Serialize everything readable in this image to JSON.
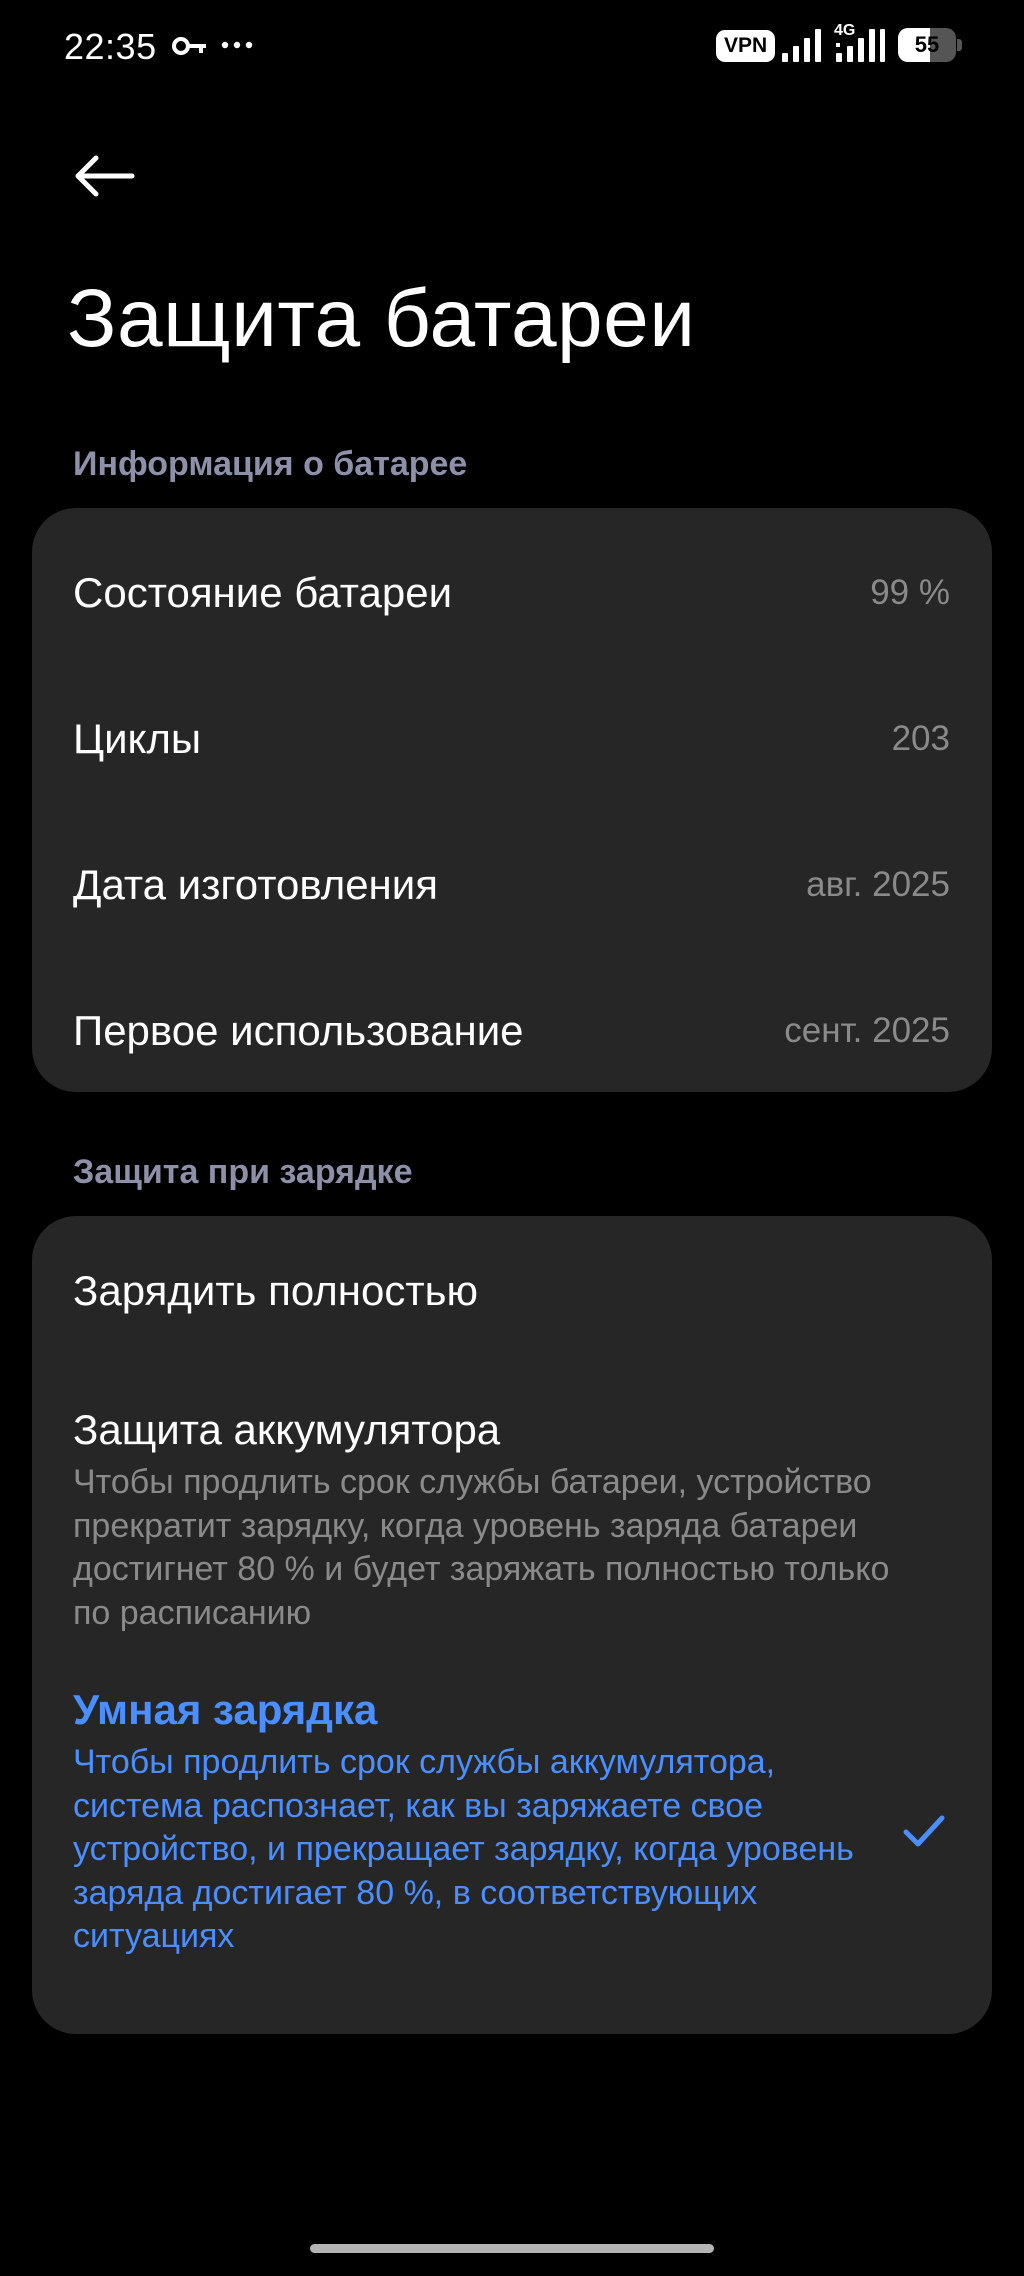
{
  "status_bar": {
    "time": "22:35",
    "vpn": "VPN",
    "network_type": "4G",
    "battery_level": "55",
    "battery_fraction": 0.55,
    "icons": [
      "key-icon",
      "more-icon",
      "signal-icon",
      "signal-icon",
      "battery-icon"
    ]
  },
  "header": {
    "back_icon": "arrow-left-icon",
    "title": "Защита батареи"
  },
  "battery_info": {
    "section_title": "Информация о батарее",
    "rows": [
      {
        "label": "Состояние батареи",
        "value": "99 %"
      },
      {
        "label": "Циклы",
        "value": "203"
      },
      {
        "label": "Дата изготовления",
        "value": "авг. 2025"
      },
      {
        "label": "Первое использование",
        "value": "сент. 2025"
      }
    ]
  },
  "charging_protection": {
    "section_title": "Защита при зарядке",
    "options": [
      {
        "title": "Зарядить полностью",
        "description": "",
        "selected": false
      },
      {
        "title": "Защита аккумулятора",
        "description": "Чтобы продлить срок службы батареи, устройство прекратит зарядку, когда уровень заряда батареи достигнет 80 % и будет заряжать полностью только по расписанию",
        "selected": false
      },
      {
        "title": "Умная зарядка",
        "description": "Чтобы продлить срок службы аккумулятора, система распознает, как вы заряжаете свое устройство, и прекращает зарядку, когда уровень заряда достигает 80 %, в соответствующих ситуациях",
        "selected": true
      }
    ],
    "selected_icon": "checkmark-icon"
  },
  "colors": {
    "background": "#000000",
    "card": "#262626",
    "accent": "#4a8eff",
    "section_header": "#8d90a8",
    "secondary_text": "#8a8a8a"
  }
}
